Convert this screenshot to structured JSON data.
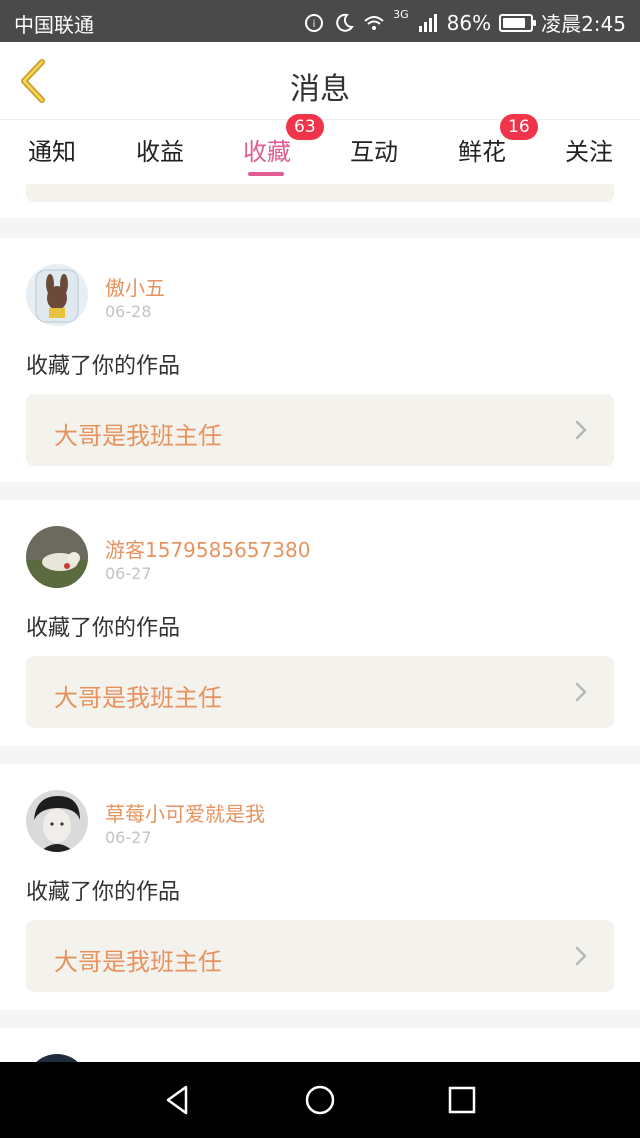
{
  "status_bar": {
    "carrier": "中国联通",
    "network": "3G",
    "battery": "86%",
    "battery_level": 0.86,
    "time": "凌晨2:45"
  },
  "header": {
    "back_icon": "chevron-left-icon",
    "title": "消息",
    "accent_color": "#e05c93"
  },
  "tabs": [
    {
      "label": "通知",
      "badge": null,
      "active": false
    },
    {
      "label": "收益",
      "badge": null,
      "active": false
    },
    {
      "label": "收藏",
      "badge": "63",
      "active": true
    },
    {
      "label": "互动",
      "badge": null,
      "active": false
    },
    {
      "label": "鲜花",
      "badge": "16",
      "active": false
    },
    {
      "label": "关注",
      "badge": null,
      "active": false
    }
  ],
  "messages": [
    {
      "user": "傲小五",
      "date": "06-28",
      "action": "收藏了你的作品",
      "work": "大哥是我班主任"
    },
    {
      "user": "游客1579585657380",
      "date": "06-27",
      "action": "收藏了你的作品",
      "work": "大哥是我班主任"
    },
    {
      "user": "草莓小可爱就是我",
      "date": "06-27",
      "action": "收藏了你的作品",
      "work": "大哥是我班主任"
    }
  ],
  "colors": {
    "name_color": "#e7935f",
    "date_color": "#c3c3c3",
    "badge_color": "#f0354b",
    "work_box_bg": "#f4f2ec"
  }
}
